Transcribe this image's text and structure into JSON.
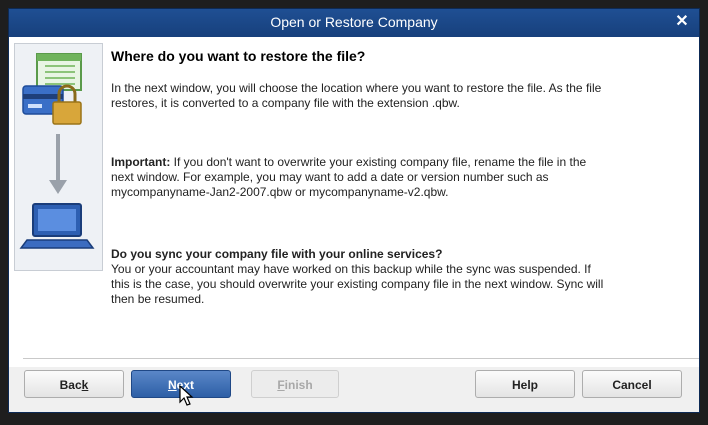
{
  "window": {
    "title": "Open or Restore Company",
    "close_glyph": "✕"
  },
  "content": {
    "heading": "Where do you want to restore the file?",
    "para1": "In the next window, you will choose the location where you want to restore the file. As the file restores, it is converted to a company file with the extension .qbw.",
    "para2_bold": "Important:",
    "para2": " If you don't want to overwrite your existing company file, rename the file in the next window. For example, you may want to add a date or version number such as mycompanyname-Jan2-2007.qbw or mycompanyname-v2.qbw.",
    "para3_bold": "Do you sync your company file with your online services?",
    "para3": "You or your accountant may have worked on this backup while the sync was suspended. If this is the case, you should overwrite your existing company file in the next window. Sync will then be resumed."
  },
  "buttons": {
    "back_pre": "Bac",
    "back_ul": "k",
    "next_ul": "N",
    "next_post": "ext",
    "finish_ul": "F",
    "finish_post": "inish",
    "help": "Help",
    "cancel": "Cancel"
  },
  "colors": {
    "titlebar": "#1f4f93",
    "next_button": "#2d5fa6"
  },
  "icons": [
    "close-icon",
    "restore-illustration",
    "mouse-cursor-icon"
  ]
}
